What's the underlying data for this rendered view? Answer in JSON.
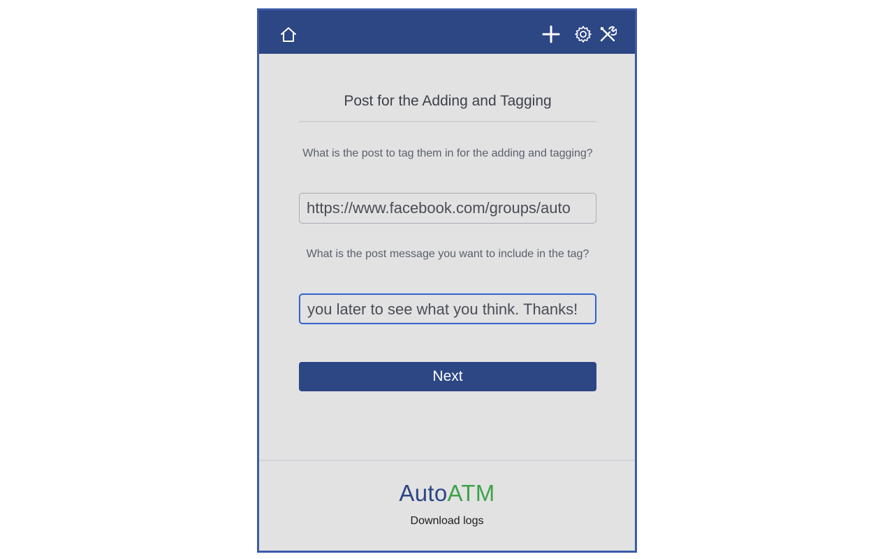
{
  "header": {
    "icons": [
      "home-icon",
      "plus-icon",
      "gear-icon",
      "tools-icon"
    ]
  },
  "main": {
    "title": "Post for the Adding and Tagging",
    "question_post": "What is the post to tag them in for the adding and tagging?",
    "post_url_value": "https://www.facebook.com/groups/auto",
    "question_message": "What is the post message you want to include in the tag?",
    "message_value": "you later to see what you think. Thanks!",
    "next_label": "Next"
  },
  "footer": {
    "brand_part1": "Auto",
    "brand_part2": "ATM",
    "download_label": "Download logs"
  },
  "colors": {
    "header_bg": "#2d4684",
    "panel_bg": "#e2e2e3",
    "brand_blue": "#2d4684",
    "brand_green": "#3fa34a",
    "focus_border": "#3b63c4"
  }
}
